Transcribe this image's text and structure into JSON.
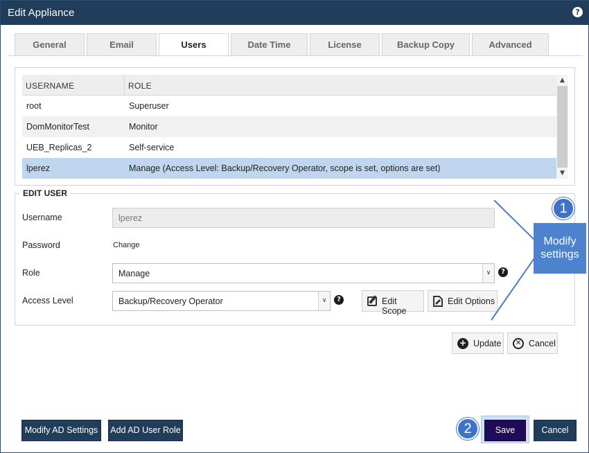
{
  "window": {
    "title": "Edit Appliance",
    "help_glyph": "?"
  },
  "tabs": [
    {
      "label": "General",
      "active": false
    },
    {
      "label": "Email",
      "active": false
    },
    {
      "label": "Users",
      "active": true
    },
    {
      "label": "Date Time",
      "active": false
    },
    {
      "label": "License",
      "active": false
    },
    {
      "label": "Backup Copy",
      "active": false
    },
    {
      "label": "Advanced",
      "active": false
    }
  ],
  "users_table": {
    "columns": [
      "USERNAME",
      "ROLE"
    ],
    "rows": [
      {
        "username": "root",
        "role": "Superuser",
        "selected": false
      },
      {
        "username": "DomMonitorTest",
        "role": "Monitor",
        "selected": false
      },
      {
        "username": "UEB_Replicas_2",
        "role": "Self-service",
        "selected": false
      },
      {
        "username": "lperez",
        "role": "Manage (Access Level: Backup/Recovery Operator, scope is set, options are set)",
        "selected": true
      }
    ],
    "scroll_up_glyph": "▲",
    "scroll_down_glyph": "▼"
  },
  "edit_user": {
    "legend": "EDIT USER",
    "username_label": "Username",
    "username_value": "lperez",
    "password_label": "Password",
    "password_link": "Change",
    "role_label": "Role",
    "role_value": "Manage",
    "access_level_label": "Access Level",
    "access_level_value": "Backup/Recovery Operator",
    "edit_scope_label": "Edit Scope",
    "edit_options_label": "Edit Options",
    "help_glyph": "?",
    "dropdown_glyph": "∨"
  },
  "actions": {
    "update_label": "Update",
    "cancel_label": "Cancel"
  },
  "footer": {
    "modify_ad_label": "Modify AD Settings",
    "add_ad_role_label": "Add AD User Role",
    "save_label": "Save",
    "cancel_label": "Cancel"
  },
  "annotations": {
    "badge1": "1",
    "badge2": "2",
    "callout_line1": "Modify",
    "callout_line2": "settings"
  },
  "colors": {
    "titlebar": "#213d5c",
    "selected_row": "#bfd6ee",
    "save_button": "#1f0b57",
    "annotation_blue": "#4c82ce"
  },
  "icons": [
    "help-icon",
    "edit-scope-icon",
    "edit-options-icon",
    "plus-circle-icon",
    "x-circle-icon",
    "chevron-down-icon",
    "scroll-up-icon",
    "scroll-down-icon"
  ]
}
